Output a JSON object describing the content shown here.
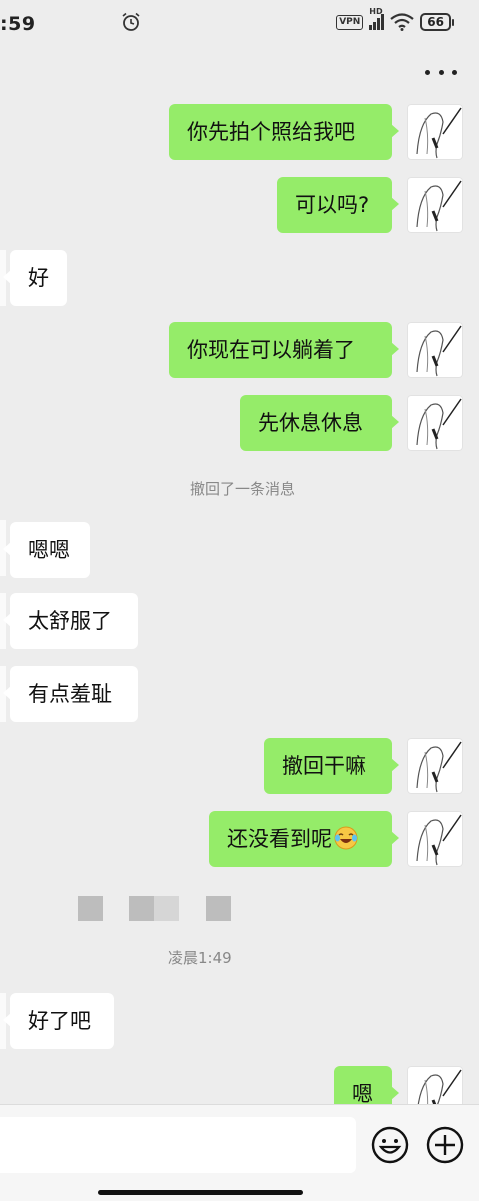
{
  "status_bar": {
    "time": ":59",
    "vpn": "VPN",
    "hd": "HD",
    "battery": "66"
  },
  "messages": [
    {
      "side": "right",
      "text": "你先拍个照给我吧"
    },
    {
      "side": "right",
      "text": "可以吗?"
    },
    {
      "side": "left",
      "text": "好"
    },
    {
      "side": "right",
      "text": "你现在可以躺着了"
    },
    {
      "side": "right",
      "text": "先休息休息"
    },
    {
      "side": "system",
      "text": "撤回了一条消息"
    },
    {
      "side": "left",
      "text": "嗯嗯"
    },
    {
      "side": "left",
      "text": "太舒服了"
    },
    {
      "side": "left",
      "text": "有点羞耻"
    },
    {
      "side": "right",
      "text": "撤回干嘛"
    },
    {
      "side": "right",
      "text": "还没看到呢",
      "emoji": "crying-laughing-emoji"
    },
    {
      "side": "system",
      "text": "凌晨1:49"
    },
    {
      "side": "left",
      "text": "好了吧"
    },
    {
      "side": "right",
      "text": "嗯"
    }
  ],
  "input_bar": {
    "icons": [
      "emoji-icon",
      "plus-icon"
    ]
  },
  "colors": {
    "background": "#ededed",
    "outgoing_bubble": "#95ec69",
    "incoming_bubble": "#ffffff",
    "system_text": "#888888"
  }
}
